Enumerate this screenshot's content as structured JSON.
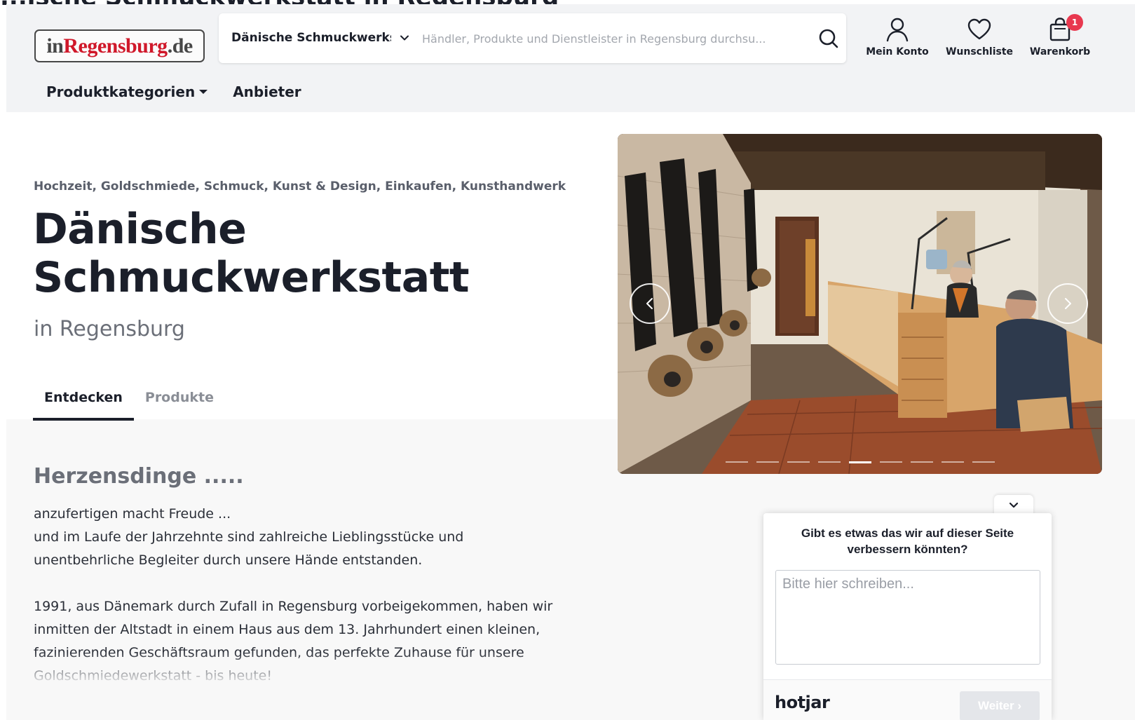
{
  "top_fragment": "...ische Schmuckwerkstatt in Regensburg",
  "logo": {
    "prefix": "in",
    "city": "Regensburg",
    "suffix": ".de"
  },
  "search": {
    "scope": "Dänische Schmuckwerkstatt",
    "placeholder": "Händler, Produkte und Dienstleister in Regensburg durchsu..."
  },
  "header_actions": {
    "account": "Mein Konto",
    "wishlist": "Wunschliste",
    "cart": "Warenkorb",
    "cart_count": "1"
  },
  "nav": {
    "categories": "Produktkategorien",
    "vendors": "Anbieter"
  },
  "breadcrumbs": "Hochzeit, Goldschmiede, Schmuck, Kunst & Design, Einkaufen, Kunsthandwerk",
  "title": "Dänische Schmuckwerkstatt",
  "subtitle": "in Regensburg",
  "tabs": [
    {
      "label": "Entdecken",
      "active": true
    },
    {
      "label": "Produkte",
      "active": false
    }
  ],
  "section": {
    "heading": "Herzensdinge .....",
    "p1": "anzufertigen macht Freude ...\nund im Laufe der Jahrzehnte sind zahlreiche Lieblingsstücke und unentbehrliche Begleiter durch unsere Hände entstanden.",
    "p2": "1991, aus Dänemark durch Zufall in Regensburg vorbeigekommen, haben wir inmitten der Altstadt in einem Haus aus dem 13. Jahrhundert einen kleinen, fazinierenden Geschäftsraum gefunden, das perfekte Zuhause für unsere Goldschmiedewerkstatt - bis heute!"
  },
  "carousel": {
    "slide_count": 9,
    "active_index": 4
  },
  "feedback": {
    "question": "Gibt es etwas das wir auf dieser Seite verbessern könnten?",
    "placeholder": "Bitte hier schreiben...",
    "brand": "hotjar",
    "next": "Weiter"
  },
  "colors": {
    "header_bg": "#f2f3f5",
    "logo_red": "#d0182a",
    "badge": "#e8384f",
    "text_dark": "#1b1f2a"
  }
}
